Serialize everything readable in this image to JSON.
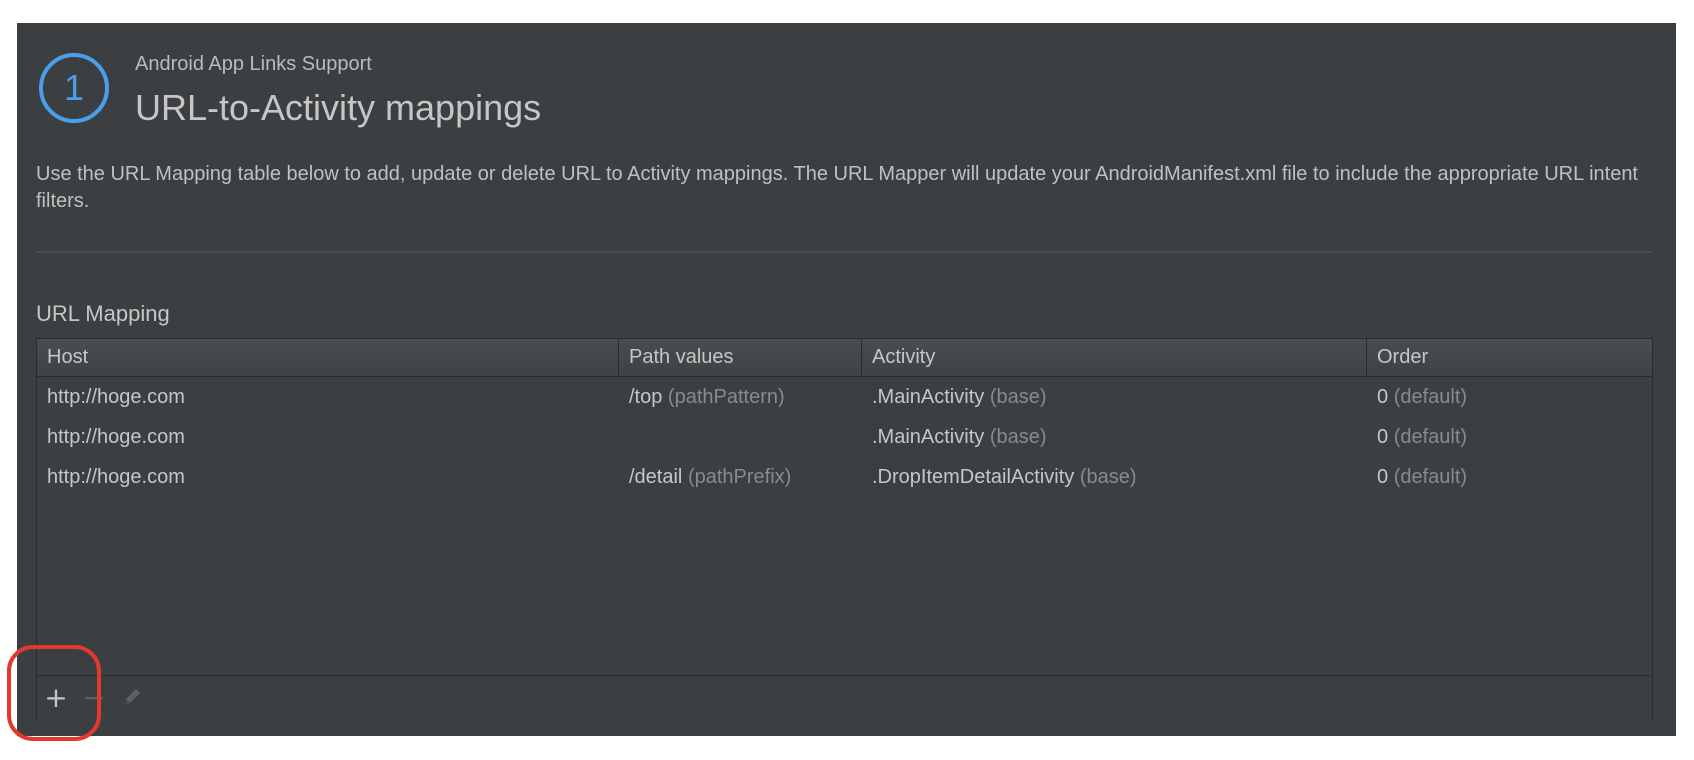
{
  "header": {
    "step_number": "1",
    "subtitle": "Android App Links Support",
    "title": "URL-to-Activity mappings"
  },
  "description": "Use the URL Mapping table below to add, update or delete URL to Activity mappings. The URL Mapper will update your AndroidManifest.xml file to include the appropriate URL intent filters.",
  "section": {
    "label": "URL Mapping"
  },
  "table": {
    "columns": [
      "Host",
      "Path values",
      "Activity",
      "Order"
    ],
    "rows": [
      {
        "host": "http://hoge.com",
        "path": "/top",
        "path_hint": "(pathPattern)",
        "activity": ".MainActivity",
        "activity_hint": "(base)",
        "order": "0",
        "order_hint": "(default)"
      },
      {
        "host": "http://hoge.com",
        "path": "",
        "path_hint": "",
        "activity": ".MainActivity",
        "activity_hint": "(base)",
        "order": "0",
        "order_hint": "(default)"
      },
      {
        "host": "http://hoge.com",
        "path": "/detail",
        "path_hint": "(pathPrefix)",
        "activity": ".DropItemDetailActivity",
        "activity_hint": "(base)",
        "order": "0",
        "order_hint": "(default)"
      }
    ]
  },
  "toolbar": {
    "add_icon": "+",
    "remove_icon": "−",
    "edit_icon": "pencil-icon"
  },
  "colors": {
    "panel_bg": "#3c3f41",
    "accent_blue": "#4a9eea",
    "highlight_red": "#e3392c"
  }
}
